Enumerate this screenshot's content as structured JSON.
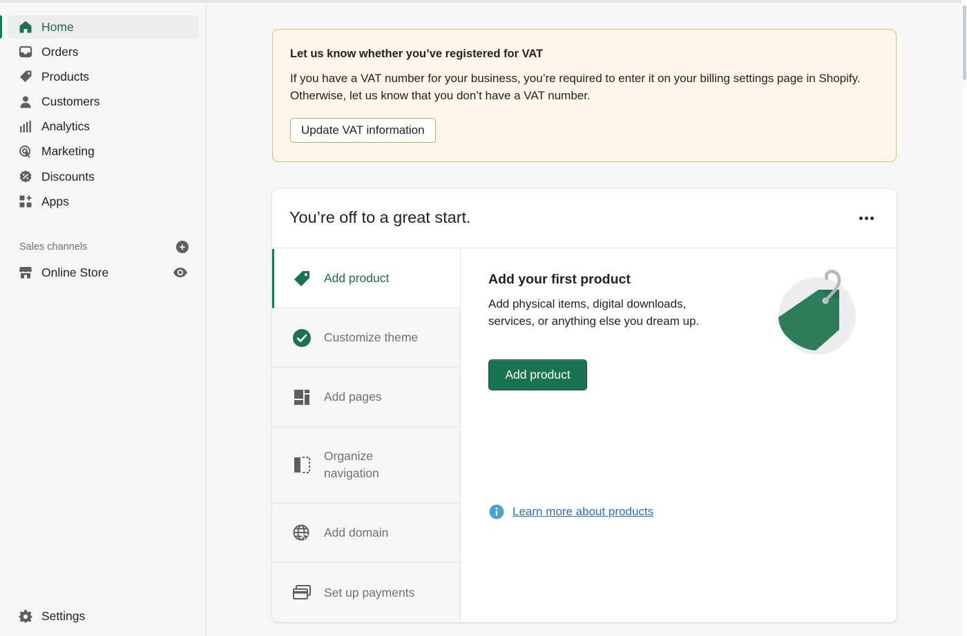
{
  "sidebar": {
    "nav": [
      {
        "label": "Home",
        "icon": "home-icon",
        "active": true
      },
      {
        "label": "Orders",
        "icon": "orders-icon"
      },
      {
        "label": "Products",
        "icon": "tag-icon"
      },
      {
        "label": "Customers",
        "icon": "person-icon"
      },
      {
        "label": "Analytics",
        "icon": "bar-chart-icon"
      },
      {
        "label": "Marketing",
        "icon": "target-icon"
      },
      {
        "label": "Discounts",
        "icon": "discount-icon"
      },
      {
        "label": "Apps",
        "icon": "apps-icon"
      }
    ],
    "sales_channels_label": "Sales channels",
    "online_store_label": "Online Store",
    "settings_label": "Settings"
  },
  "banner": {
    "title": "Let us know whether you’ve registered for VAT",
    "text": "If you have a VAT number for your business, you’re required to enter it on your billing settings page in Shopify. Otherwise, let us know that you don’t have a VAT number.",
    "button_label": "Update VAT information"
  },
  "setup": {
    "title": "You’re off to a great start.",
    "steps": [
      {
        "label": "Add product",
        "icon": "tag-icon",
        "active": true
      },
      {
        "label": "Customize theme",
        "icon": "check-circle-icon"
      },
      {
        "label": "Add pages",
        "icon": "pages-icon"
      },
      {
        "label": "Organize navigation",
        "icon": "navigation-icon"
      },
      {
        "label": "Add domain",
        "icon": "globe-icon"
      },
      {
        "label": "Set up payments",
        "icon": "payments-icon"
      }
    ],
    "detail_title": "Add your first product",
    "detail_text": "Add physical items, digital downloads, services, or anything else you dream up.",
    "primary_button_label": "Add product",
    "learn_more_label": "Learn more about products"
  },
  "colors": {
    "accent": "#008060",
    "primary_button": "#1a7350",
    "banner_bg": "#fff5ea",
    "banner_border": "#e1b878",
    "link": "#2c6ecb"
  }
}
